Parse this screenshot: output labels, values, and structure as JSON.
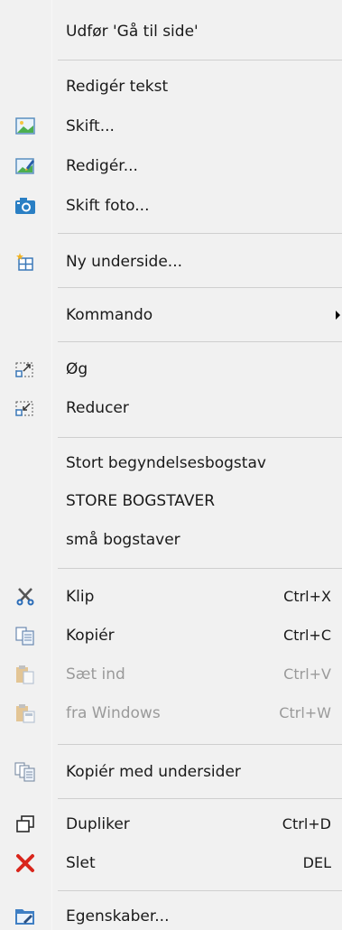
{
  "menu": {
    "goto": {
      "label": "Udfør 'Gå til side'"
    },
    "edit_text": {
      "label": "Redigér tekst"
    },
    "replace": {
      "label": "Skift...",
      "icon": "image-icon"
    },
    "edit": {
      "label": "Redigér...",
      "icon": "image-edit-icon"
    },
    "replace_photo": {
      "label": "Skift foto...",
      "icon": "camera-icon"
    },
    "new_subpage": {
      "label": "Ny underside...",
      "icon": "new-page-icon"
    },
    "command": {
      "label": "Kommando",
      "icon": "submenu-arrow-icon"
    },
    "grow": {
      "label": "Øg",
      "icon": "grow-icon"
    },
    "shrink": {
      "label": "Reducer",
      "icon": "shrink-icon"
    },
    "capitalize": {
      "label": "Stort begyndelsesbogstav"
    },
    "upper": {
      "label": "STORE BOGSTAVER"
    },
    "lower": {
      "label": "små bogstaver"
    },
    "cut": {
      "label": "Klip",
      "shortcut": "Ctrl+X",
      "icon": "scissors-icon"
    },
    "copy": {
      "label": "Kopiér",
      "shortcut": "Ctrl+C",
      "icon": "copy-icon"
    },
    "paste": {
      "label": "Sæt ind",
      "shortcut": "Ctrl+V",
      "icon": "paste-icon"
    },
    "paste_windows": {
      "label": "fra Windows",
      "shortcut": "Ctrl+W",
      "icon": "paste-windows-icon"
    },
    "copy_subpages": {
      "label": "Kopiér med undersider",
      "icon": "copy-subpages-icon"
    },
    "duplicate": {
      "label": "Dupliker",
      "shortcut": "Ctrl+D",
      "icon": "duplicate-icon"
    },
    "delete": {
      "label": "Slet",
      "shortcut": "DEL",
      "icon": "delete-icon"
    },
    "properties": {
      "label": "Egenskaber...",
      "icon": "properties-icon"
    }
  },
  "colors": {
    "background": "#f1f1f1",
    "separator": "#cfcfcf",
    "disabled_text": "#9a9a9a",
    "delete_red": "#d9261c"
  }
}
